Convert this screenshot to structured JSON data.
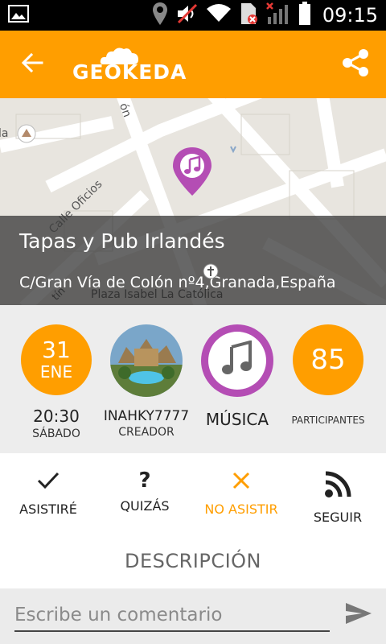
{
  "status_bar": {
    "time": "09:15",
    "icons": [
      "image-icon",
      "location-icon",
      "mute-icon",
      "wifi-icon",
      "sim-icon",
      "no-signal-icon",
      "battery-icon"
    ]
  },
  "app_bar": {
    "logo_text": "GEOKEDA",
    "back_icon": "arrow-left-icon",
    "share_icon": "share-icon",
    "color": "#ff9e00"
  },
  "map": {
    "labels": {
      "street_1": "Calle Oficios",
      "street_2": "Plaza Isabel La Católica",
      "street_3": "ón",
      "edge_label": "la",
      "edge_label_2": "tín"
    },
    "pin_icon": "music-note-icon"
  },
  "event": {
    "title": "Tapas y Pub Irlandés",
    "address": "C/Gran Vía de Colón nº4,Granada,España"
  },
  "info": {
    "date": {
      "day": "31",
      "month": "ENE",
      "time": "20:30",
      "weekday": "SÁBADO"
    },
    "creator": {
      "name": "INAHKY7777",
      "role": "CREADOR"
    },
    "category": {
      "label": "MÚSICA",
      "icon": "music-note-icon",
      "color": "#b44db4"
    },
    "participants": {
      "count": "85",
      "label": "PARTICIPANTES"
    }
  },
  "actions": [
    {
      "label": "ASISTIRÉ",
      "icon": "check-icon"
    },
    {
      "label": "QUIZÁS",
      "icon": "question-icon"
    },
    {
      "label": "NO ASISTIR",
      "icon": "close-icon",
      "active": true
    },
    {
      "label": "SEGUIR",
      "icon": "rss-icon"
    }
  ],
  "description": {
    "title": "DESCRIPCIÓN"
  },
  "comment": {
    "placeholder": "Escribe un comentario",
    "send_icon": "send-icon"
  }
}
